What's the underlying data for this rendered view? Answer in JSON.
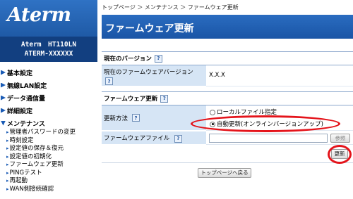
{
  "logo": {
    "text": "Aterm"
  },
  "model": {
    "name": "Aterm　HT110LN",
    "id": "ATERM-XXXXXX"
  },
  "nav": {
    "basic": "基本設定",
    "wlan": "無線LAN設定",
    "data": "データ通信量",
    "detail": "詳細設定",
    "maintenance": "メンテナンス",
    "sub": [
      "管理者パスワードの変更",
      "時刻設定",
      "設定値の保存＆復元",
      "設定値の初期化",
      "ファームウェア更新",
      "PINGテスト",
      "再起動",
      "WAN側接続確認"
    ]
  },
  "breadcrumb": "トップページ ＞ メンテナンス ＞ ファームウェア更新",
  "page_title": "ファームウェア更新",
  "help_mark": "?",
  "current_version": {
    "section_title": "現在のバージョン",
    "label": "現在のファームウェアバージョン",
    "value": "X.X.X"
  },
  "update": {
    "section_title": "ファームウェア更新",
    "method_label": "更新方法",
    "option_local": "ローカルファイル指定",
    "option_auto": "自動更新(オンラインバージョンアップ)",
    "file_label": "ファームウェアファイル",
    "browse_button": "参照",
    "update_button": "更新"
  },
  "back_button": "トップページへ戻る",
  "colors": {
    "accent": "#1a55a6",
    "highlight": "#e4141b",
    "label_bg": "#d6e5f5"
  }
}
